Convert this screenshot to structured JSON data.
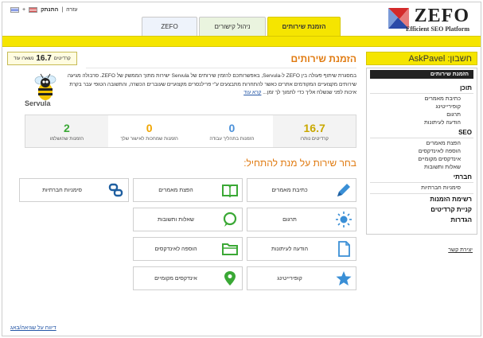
{
  "logo": {
    "name": "ZEFO",
    "tagline": "Efficient SEO Platform"
  },
  "toplinks": {
    "logout": "התנתק",
    "help": "עזרה",
    "lang_en": "+",
    "lang_he": ""
  },
  "tabs": {
    "order": "הזמנת שירותים",
    "links": "ניהול קישורים",
    "zefo": "ZEFO"
  },
  "account": {
    "label": "חשבון: AskPavel"
  },
  "sidebar": {
    "active": "הזמנת שירותים",
    "content_title": "תוכן",
    "content_items": [
      "כתיבת מאמרים",
      "קופירייטינג",
      "תרגום",
      "הודעה לעיתונות"
    ],
    "seo_title": "SEO",
    "seo_items": [
      "הפצת מאמרים",
      "הוספה לאינדקסים",
      "אינדקסים מקומיים",
      "שאלות ותשובות"
    ],
    "social_title": "חברתי",
    "social_items": [
      "סימניות חברתיות"
    ],
    "orders": "רשימת הזמנות",
    "buy_credits": "קניית קרדיטים",
    "settings": "הגדרות",
    "contact": "יצירת קשר"
  },
  "main": {
    "title": "הזמנת שירותים",
    "credits_remaining_label": "נשארו עוד",
    "credits_remaining_value": "16.7",
    "credits_remaining_unit": "קרדיטים",
    "mascot_label": "Servula",
    "intro": "במסגרת שיתוף פעולה בין ZEFO ל-Servula, באפשרותכם להזמין שירותים של Servula ישירות מתוך הממשק של ZEFO. סרבולה מגיעה שירותים מקצועיים המקודמים אתרים כאשר להתחרות מתבצעים ע\"י פרילנסרים מקצועיים שעוברים הכשרה, והתשובה הטופי עבר בקרת איכות לפני שנשלח אליך כדי לתמוך לך זמן...",
    "intro_more": "קרא עוד",
    "stats": [
      {
        "value": "16.7",
        "label": "קרדיטים נותרו"
      },
      {
        "value": "0",
        "label": "הזמנות בתהליך עבודה"
      },
      {
        "value": "0",
        "label": "הזמנות שמחכות לאישור שלך"
      },
      {
        "value": "2",
        "label": "הזמנות שהושלמו"
      }
    ],
    "choose_title": "בחר שירות על מנת להתחיל:",
    "services": [
      {
        "label": "כתיבת מאמרים",
        "icon": "pen-icon"
      },
      {
        "label": "הפצת מאמרים",
        "icon": "book-icon"
      },
      {
        "label": "סימניות חברתיות",
        "icon": "social-bookmark-icon"
      },
      {
        "label": "תרגום",
        "icon": "sun-icon"
      },
      {
        "label": "שאלות ותשובות",
        "icon": "speech-bubble-icon"
      },
      {
        "label": "הודעה לעיתונות",
        "icon": "document-icon"
      },
      {
        "label": "הוספה לאינדקסים",
        "icon": "folder-icon"
      },
      {
        "label": "קופירייטינג",
        "icon": "star-icon"
      },
      {
        "label": "אינדקסים מקומיים",
        "icon": "map-pin-icon"
      }
    ]
  },
  "footer": {
    "report_bug": "דיווח על שגיאה/באג"
  },
  "colors": {
    "brand_yellow": "#f5e500",
    "orange": "#e07a10",
    "green": "#3aa835",
    "blue": "#4a90d9",
    "gold": "#c9a800"
  }
}
